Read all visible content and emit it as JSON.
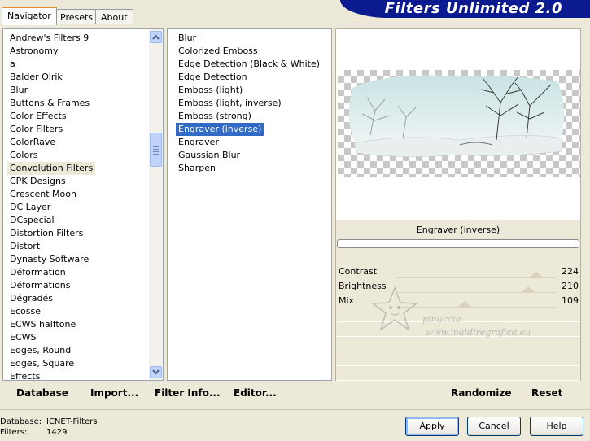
{
  "tabs": [
    {
      "label": "Navigator",
      "active": true
    },
    {
      "label": "Presets",
      "active": false
    },
    {
      "label": "About",
      "active": false
    }
  ],
  "banner": {
    "title": "Filters Unlimited 2.0"
  },
  "categories": {
    "items": [
      "Andrew's Filters 9",
      "Astronomy",
      "a",
      "Balder Olrik",
      "Blur",
      "Buttons & Frames",
      "Color Effects",
      "Color Filters",
      "ColorRave",
      "Colors",
      "Convolution Filters",
      "CPK Designs",
      "Crescent Moon",
      "DC Layer",
      "DCspecial",
      "Distortion Filters",
      "Distort",
      "Dynasty Software",
      "Déformation",
      "Déformations",
      "Dégradés",
      "Ecosse",
      "ECWS halftone",
      "ECWS",
      "Edges, Round",
      "Edges, Square",
      "Effects"
    ],
    "selected": "Convolution Filters"
  },
  "filters": {
    "items": [
      "Blur",
      "Colorized Emboss",
      "Edge Detection (Black & White)",
      "Edge Detection",
      "Emboss (light)",
      "Emboss (light, inverse)",
      "Emboss (strong)",
      "Engraver (inverse)",
      "Engraver",
      "Gaussian Blur",
      "Sharpen"
    ],
    "selected": "Engraver (inverse)"
  },
  "preview": {
    "filter_name": "Engraver (inverse)",
    "watermark_line1": "pinuccia",
    "watermark_line2": "www.maldiregrafica.eu"
  },
  "sliders": [
    {
      "label": "Contrast",
      "value": "224",
      "fraction": 0.878
    },
    {
      "label": "Brightness",
      "value": "210",
      "fraction": 0.824
    },
    {
      "label": "Mix",
      "value": "109",
      "fraction": 0.427
    }
  ],
  "toolbar": {
    "database": "Database",
    "import": "Import...",
    "filter_info": "Filter Info...",
    "editor": "Editor...",
    "randomize": "Randomize",
    "reset": "Reset"
  },
  "status": {
    "database_label": "Database:",
    "database_value": "ICNET-Filters",
    "filters_label": "Filters:",
    "filters_value": "1429"
  },
  "buttons": {
    "apply": "Apply",
    "cancel": "Cancel",
    "help": "Help"
  },
  "colors": {
    "banner": "#0b1a8e",
    "selection": "#316ac5",
    "tab_accent": "#e68b2c"
  }
}
